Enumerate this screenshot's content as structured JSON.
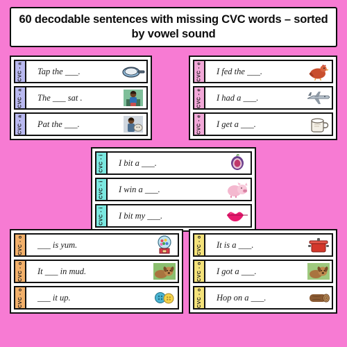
{
  "title": "60 decodable sentences with missing CVC words – sorted by vowel sound",
  "colors": {
    "background": "#f77bd3",
    "card": "#ffffff",
    "outline": "#111111",
    "tab_a": "#b9b9f0",
    "tab_e": "#f2a8d8",
    "tab_i": "#7be8e0",
    "tab_o": "#f2b06a",
    "tab_u": "#f4e27a"
  },
  "groups": [
    {
      "id": "a",
      "tab_label": "CVC - a",
      "tab_color": "#b9b9f0",
      "cards": [
        {
          "sentence": "Tap the ___.",
          "icon": "frying-pan-icon"
        },
        {
          "sentence": "The ___ sat .",
          "icon": "boy-sitting-icon"
        },
        {
          "sentence": "Pat the ___.",
          "icon": "child-with-cat-icon"
        }
      ]
    },
    {
      "id": "e",
      "tab_label": "CVC - e",
      "tab_color": "#f2a8d8",
      "cards": [
        {
          "sentence": "I fed the ___.",
          "icon": "hen-icon"
        },
        {
          "sentence": "I had a ___.",
          "icon": "jet-icon"
        },
        {
          "sentence": "I get a ___.",
          "icon": "mug-of-milk-icon"
        }
      ]
    },
    {
      "id": "i",
      "tab_label": "CVC - i",
      "tab_color": "#7be8e0",
      "cards": [
        {
          "sentence": "I bit a ___.",
          "icon": "fig-icon"
        },
        {
          "sentence": "I win a ___.",
          "icon": "pig-icon"
        },
        {
          "sentence": "I bit my ___.",
          "icon": "lips-icon"
        }
      ]
    },
    {
      "id": "o",
      "tab_label": "CVC - o",
      "tab_color": "#f2b06a",
      "cards": [
        {
          "sentence": "___ is yum.",
          "icon": "gumball-machine-icon"
        },
        {
          "sentence": "It ___ in mud.",
          "icon": "dog-icon"
        },
        {
          "sentence": "___ it up.",
          "icon": "button-icon"
        }
      ]
    },
    {
      "id": "u",
      "tab_label": "CVC - o",
      "tab_color": "#f4e27a",
      "cards": [
        {
          "sentence": "It is a ___.",
          "icon": "pot-icon"
        },
        {
          "sentence": "I got a ___.",
          "icon": "dog-icon"
        },
        {
          "sentence": "Hop on a ___.",
          "icon": "log-icon"
        }
      ]
    }
  ]
}
